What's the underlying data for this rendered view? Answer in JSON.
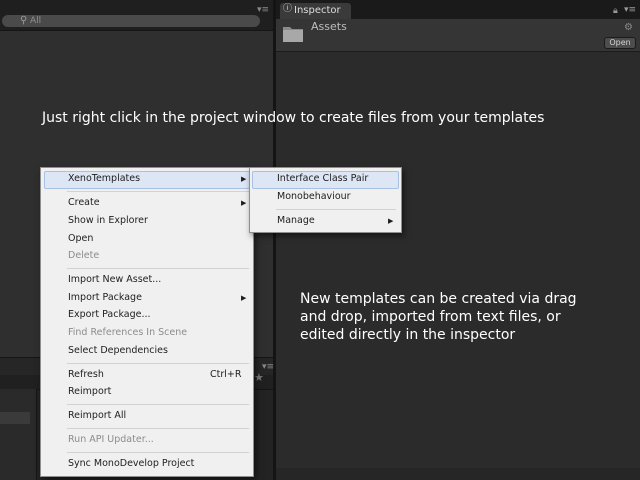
{
  "project": {
    "search_placeholder": "All"
  },
  "inspector": {
    "tab_label": "Inspector",
    "title": "Assets",
    "open_button": "Open"
  },
  "captions": {
    "top": "Just right click in the project window to create files from your templates",
    "right_line1": "New templates can be created via drag",
    "right_line2": "and drop, imported from text files, or",
    "right_line3": "edited directly in the inspector"
  },
  "context_menu": {
    "items": [
      {
        "label": "XenoTemplates",
        "submenu": true,
        "highlighted": true
      },
      {
        "label": "Create",
        "submenu": true
      },
      {
        "label": "Show in Explorer"
      },
      {
        "label": "Open"
      },
      {
        "label": "Delete",
        "disabled": true
      },
      {
        "label": "Import New Asset..."
      },
      {
        "label": "Import Package",
        "submenu": true
      },
      {
        "label": "Export Package..."
      },
      {
        "label": "Find References In Scene",
        "disabled": true
      },
      {
        "label": "Select Dependencies"
      },
      {
        "label": "Refresh",
        "shortcut": "Ctrl+R"
      },
      {
        "label": "Reimport"
      },
      {
        "label": "Reimport All"
      },
      {
        "label": "Run API Updater...",
        "disabled": true
      },
      {
        "label": "Sync MonoDevelop Project"
      }
    ]
  },
  "submenu": {
    "items": [
      {
        "label": "Interface Class Pair",
        "highlighted": true
      },
      {
        "label": "Monobehaviour"
      },
      {
        "label": "Manage",
        "submenu": true
      }
    ]
  },
  "icons": {
    "search": "search-icon",
    "folder": "folder-icon",
    "lock": "lock-icon",
    "gear": "gear-icon",
    "menu": "panel-menu-icon",
    "info": "info-icon",
    "star": "star-icon",
    "submenu_arrow": "triangle-right-icon"
  },
  "colors": {
    "menu_bg": "#f0f0f0",
    "highlight": "#dce6f4",
    "panel": "#2f2f2f",
    "inspector": "#2b2b2b",
    "caption_text": "#ffffff"
  }
}
